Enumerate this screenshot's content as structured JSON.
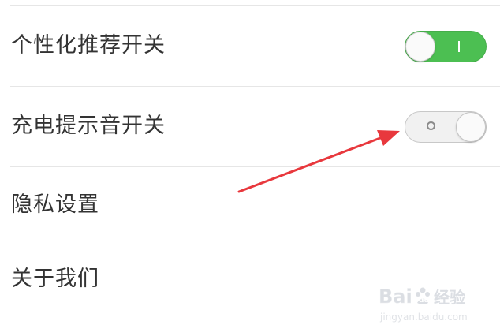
{
  "settings": {
    "items": [
      {
        "label": "个性化推荐开关",
        "toggle": "on"
      },
      {
        "label": "充电提示音开关",
        "toggle": "off"
      },
      {
        "label": "隐私设置"
      },
      {
        "label": "关于我们"
      }
    ]
  },
  "colors": {
    "toggle_on": "#4cbf52",
    "toggle_off": "#f1f1f1",
    "arrow": "#e8383d"
  },
  "watermark": {
    "brand": "Baidu经验",
    "url": "jingyan.baidu.com"
  }
}
